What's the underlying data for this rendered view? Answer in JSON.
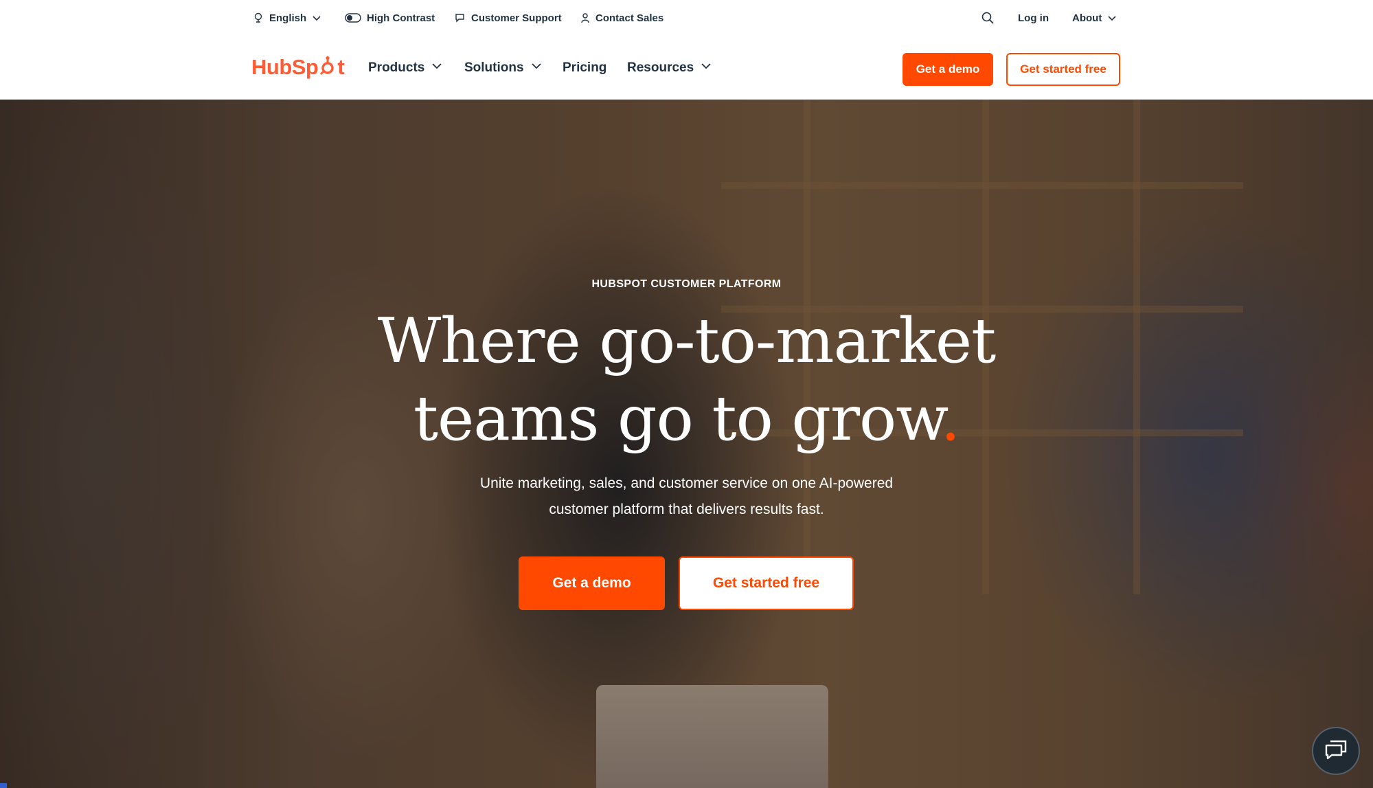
{
  "utility_bar": {
    "language": {
      "label": "English",
      "icon": "globe-icon"
    },
    "high_contrast": {
      "label": "High Contrast",
      "icon": "toggle-icon"
    },
    "support": {
      "label": "Customer Support",
      "icon": "chat-bubble-icon"
    },
    "contact": {
      "label": "Contact Sales",
      "icon": "person-icon"
    },
    "search": {
      "icon": "search-icon"
    },
    "login": {
      "label": "Log in"
    },
    "about": {
      "label": "About"
    }
  },
  "nav": {
    "logo": {
      "text_before": "HubSp",
      "text_after": "t"
    },
    "items": [
      {
        "label": "Products",
        "has_dropdown": true
      },
      {
        "label": "Solutions",
        "has_dropdown": true
      },
      {
        "label": "Pricing",
        "has_dropdown": false
      },
      {
        "label": "Resources",
        "has_dropdown": true
      }
    ],
    "demo_label": "Get a demo",
    "start_label": "Get started free"
  },
  "hero": {
    "eyebrow": "HUBSPOT CUSTOMER PLATFORM",
    "title_line1": "Where go-to-market",
    "title_line2": "teams go to grow",
    "title_dot": ".",
    "subtitle_line1": "Unite marketing, sales, and customer service on one AI-powered",
    "subtitle_line2": "customer platform that delivers results fast.",
    "demo_label": "Get a demo",
    "start_label": "Get started free"
  },
  "chat": {
    "icon": "chat-icon"
  },
  "colors": {
    "brand": "#ff4800",
    "logo": "#ff5c35",
    "text": "#213343",
    "chat_bg": "#1f2a33"
  }
}
